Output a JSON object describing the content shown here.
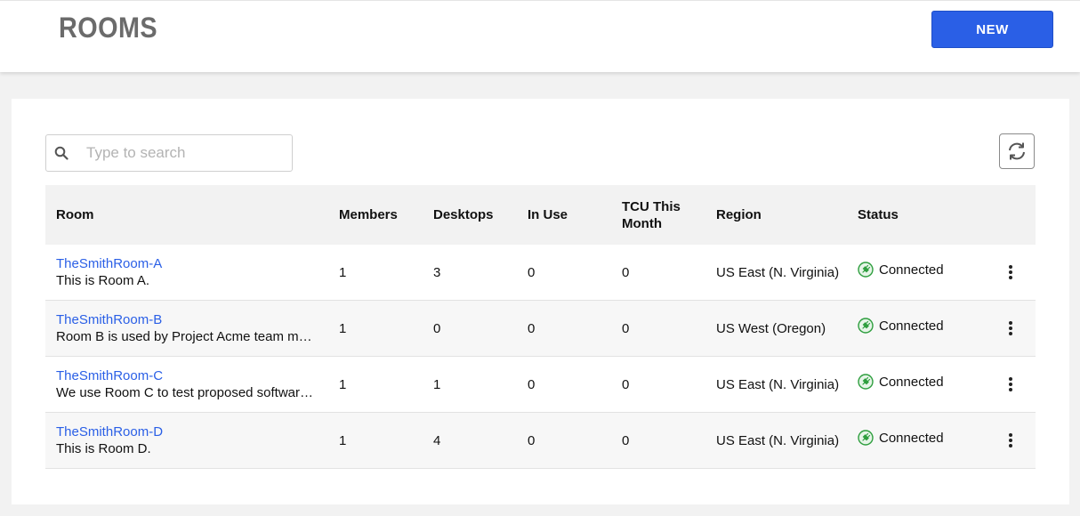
{
  "header": {
    "title": "ROOMS",
    "new_button": "NEW"
  },
  "search": {
    "placeholder": "Type to search",
    "value": ""
  },
  "table": {
    "columns": [
      "Room",
      "Members",
      "Desktops",
      "In Use",
      "TCU This Month",
      "Region",
      "Status"
    ],
    "rows": [
      {
        "name": "TheSmithRoom-A",
        "description": "This is Room A.",
        "members": "1",
        "desktops": "3",
        "in_use": "0",
        "tcu": "0",
        "region": "US East (N. Virginia)",
        "status": "Connected"
      },
      {
        "name": "TheSmithRoom-B",
        "description": "Room B is used by Project Acme team me…",
        "members": "1",
        "desktops": "0",
        "in_use": "0",
        "tcu": "0",
        "region": "US West (Oregon)",
        "status": "Connected"
      },
      {
        "name": "TheSmithRoom-C",
        "description": "We use Room C to test proposed software…",
        "members": "1",
        "desktops": "1",
        "in_use": "0",
        "tcu": "0",
        "region": "US East (N. Virginia)",
        "status": "Connected"
      },
      {
        "name": "TheSmithRoom-D",
        "description": "This is Room D.",
        "members": "1",
        "desktops": "4",
        "in_use": "0",
        "tcu": "0",
        "region": "US East (N. Virginia)",
        "status": "Connected"
      }
    ]
  },
  "icons": {
    "search": "search-icon",
    "refresh": "refresh-icon",
    "status": "connected-plug-icon",
    "row_menu": "more-vertical-icon"
  },
  "colors": {
    "accent": "#2a5fe6",
    "status_green": "#2e9e3e",
    "link": "#2a5fe6"
  }
}
